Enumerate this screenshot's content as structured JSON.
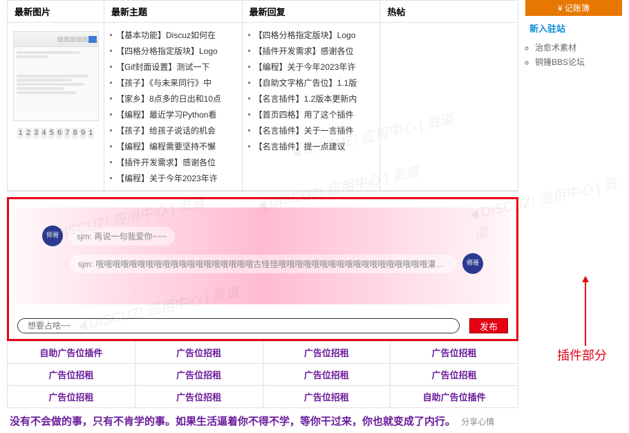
{
  "tabs": {
    "images": "最新图片",
    "topics": "最新主题",
    "replies": "最新回复",
    "hot": "热帖"
  },
  "pager": [
    "1",
    "2",
    "3",
    "4",
    "5",
    "6",
    "7",
    "8",
    "9",
    "1"
  ],
  "topics_list": [
    "【基本功能】Discuz如何在",
    "【四格分格指定版块】Logo",
    "【Gif封面设置】测试一下",
    "【孩子】《与未来同行》中",
    "【家乡】8点多的日出和10点",
    "【编程】最近学习Python看",
    "【孩子】给孩子说话的机会",
    "【编程】编程需要坚持不懈",
    "【插件开发需求】感谢各位",
    "【编程】关于今年2023年许"
  ],
  "replies_list": [
    "【四格分格指定版块】Logo",
    "【插件开发需求】感谢各位",
    "【编程】关于今年2023年许",
    "【自助文字格广告位】1.1版",
    "【名言插件】1.2版本更新内",
    "【首页四格】用了这个插件",
    "【名言插件】关于一言插件",
    "【名言插件】提一点建议"
  ],
  "shout": {
    "msg1_user": "sjm:",
    "msg1_text": "再说一句我爱你~~~",
    "msg2_user": "sjm:",
    "msg2_text": "哦哦哦哦哦哦哦哦哦哦哦哦哦哦哦哦哦哦哦古怪怪哦哦哦哦哦哦哦哦哦哦哦哦哦哦哦哦哦哦灌灌灌",
    "input_placeholder": "想要占啥~~",
    "publish": "发布",
    "avatar_text": "师哥"
  },
  "ads": {
    "row1": [
      "自助广告位插件",
      "广告位招租",
      "广告位招租",
      "广告位招租"
    ],
    "row2": [
      "广告位招租",
      "广告位招租",
      "广告位招租",
      "广告位招租"
    ],
    "row3": [
      "广告位招租",
      "广告位招租",
      "广告位招租",
      "自助广告位插件"
    ]
  },
  "quote": {
    "text": "没有不会做的事，只有不肯学的事。如果生活逼着你不得不学，等你干过来，你也就变成了内行。",
    "sub": "分享心情"
  },
  "sidebar": {
    "btn": "¥ 记账簿",
    "section": "新入驻站",
    "items": [
      "治愈术素材",
      "铜锤BBS论坛"
    ]
  },
  "annotation": "插件部分",
  "watermark": "DISCUZ! 应用中心 | 贡道"
}
